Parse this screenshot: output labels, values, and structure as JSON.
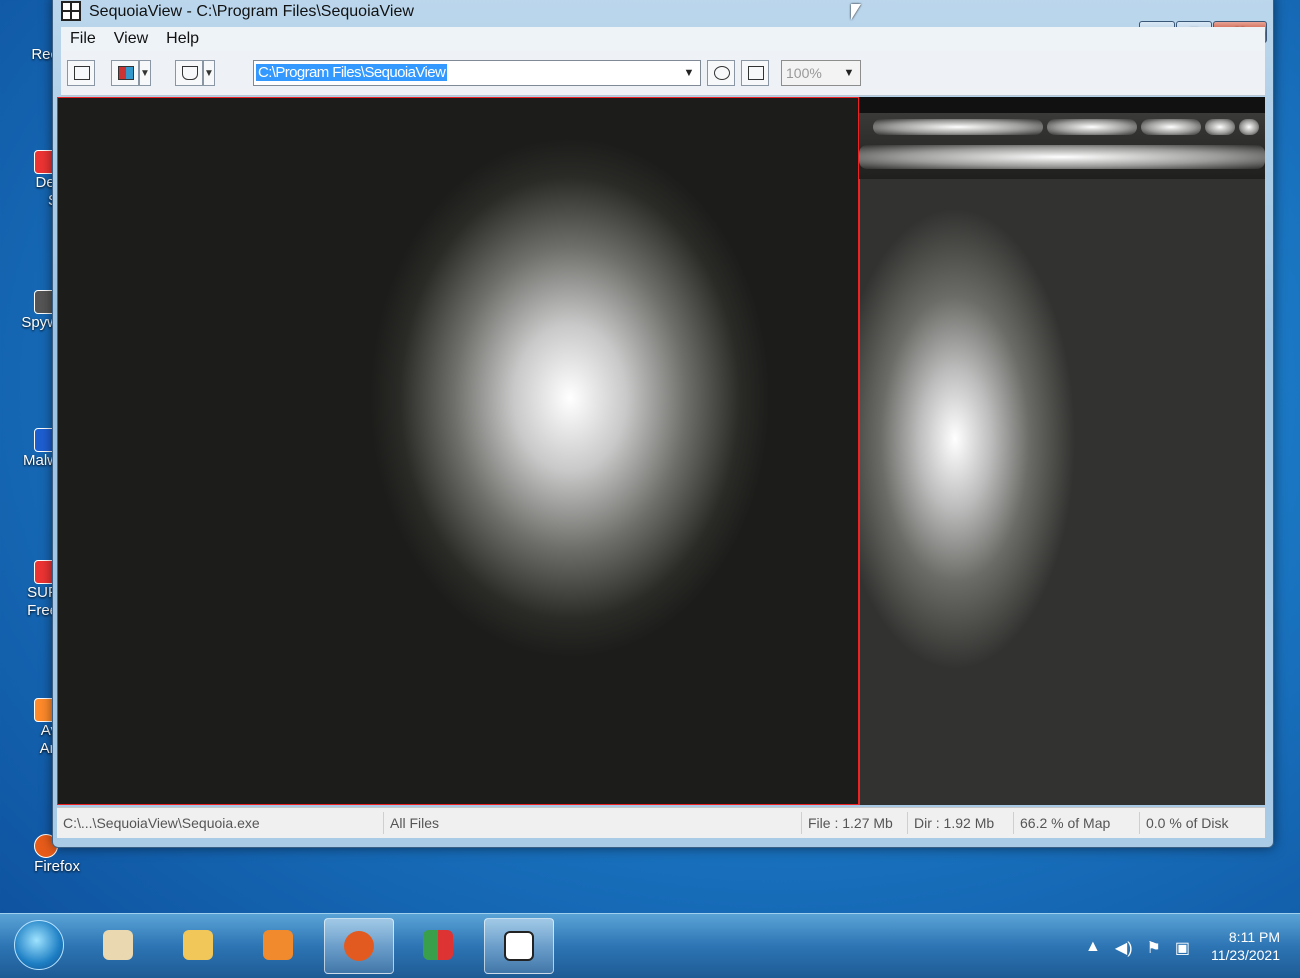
{
  "window": {
    "title": "SequoiaView - C:\\Program Files\\SequoiaView",
    "buttons": {
      "minimize": "–",
      "maximize": "□",
      "close": "✕"
    }
  },
  "menu": [
    "File",
    "View",
    "Help"
  ],
  "toolbar": {
    "path": "C:\\Program Files\\SequoiaView",
    "zoom": "100%"
  },
  "status": {
    "selected_file": "C:\\...\\SequoiaView\\Sequoia.exe",
    "filter": "All Files",
    "file_size": "File : 1.27 Mb",
    "dir_size": "Dir : 1.92 Mb",
    "percent_map": "66.2 % of Map",
    "percent_disk": "0.0 % of Disk"
  },
  "desktop_icons": [
    "Rec",
    "Del",
    "S",
    "Spyw",
    "Malw",
    "SUP",
    "Free",
    "Av",
    "An",
    "Firefox"
  ],
  "taskbar": {
    "time": "8:11 PM",
    "date": "11/23/2021"
  },
  "colors": {
    "highlight": "#e22222",
    "selection": "#3399ff"
  }
}
